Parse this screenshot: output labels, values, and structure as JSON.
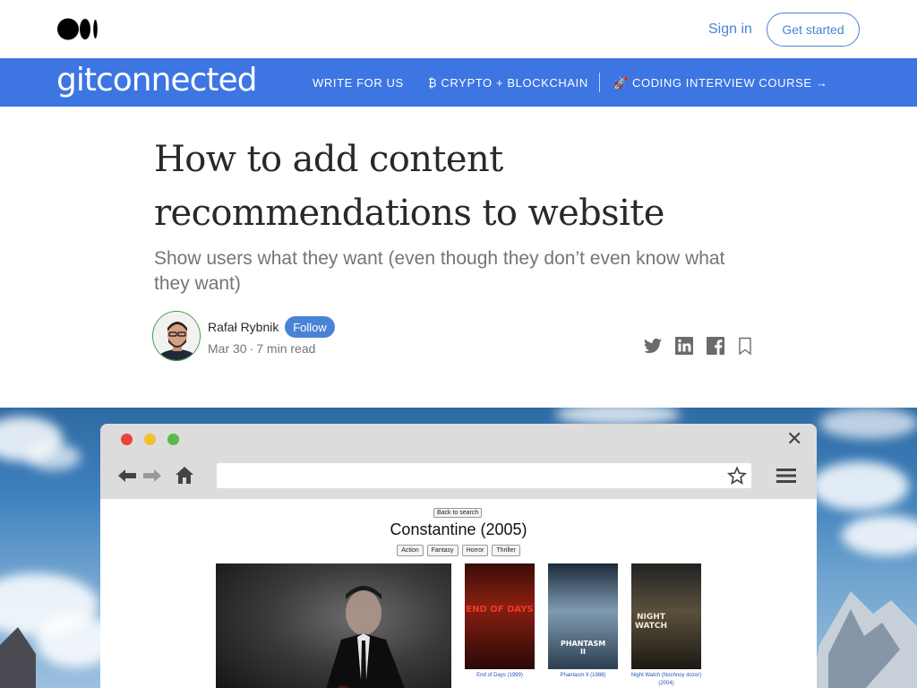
{
  "topbar": {
    "logo_icon": "medium-logo-icon",
    "signin_label": "Sign in",
    "getstarted_label": "Get started",
    "accent_color": "#4a83d6"
  },
  "publication": {
    "logo_text": "gitconnected",
    "background_color": "#3d75e3",
    "nav": [
      {
        "label": "WRITE FOR US"
      },
      {
        "label": "₿ CRYPTO + BLOCKCHAIN"
      },
      {
        "label": "🚀 CODING INTERVIEW COURSE →"
      }
    ]
  },
  "article": {
    "title": "How to add content recommendations to website",
    "subtitle": "Show users what they want (even though they don’t even know what they want)",
    "author": "Rafał Rybnik",
    "follow_label": "Follow",
    "date": "Mar 30",
    "separator": "·",
    "read_time": "7 min read",
    "share_icons": [
      "twitter-icon",
      "linkedin-icon",
      "facebook-icon",
      "bookmark-icon"
    ]
  },
  "hero": {
    "browser": {
      "back_search_label": "Back to search",
      "movie_title": "Constantine (2005)",
      "genres": [
        "Action",
        "Fantasy",
        "Horror",
        "Thriller"
      ],
      "recommendations": [
        {
          "poster_text": "END OF DAYS",
          "caption": "End of Days (1999)"
        },
        {
          "poster_text": "PHANTASM II",
          "caption": "Phantasm II (1988)"
        },
        {
          "poster_text": "NIGHT WATCH",
          "caption": "Night Watch (Nochnoy dozor) (2004)"
        }
      ]
    }
  }
}
